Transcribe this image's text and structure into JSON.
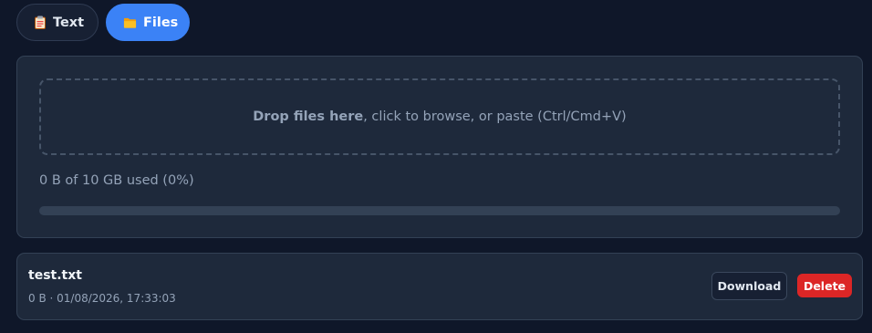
{
  "tabs": [
    {
      "label": "Text",
      "icon": "clipboard-icon",
      "active": false
    },
    {
      "label": "Files",
      "icon": "folder-icon",
      "active": true
    }
  ],
  "upload": {
    "drop_strong": "Drop files here",
    "drop_rest": ", click to browse, or paste (Ctrl/Cmd+V)",
    "usage_text": "0 B of 10 GB used (0%)",
    "usage_fraction": 0
  },
  "files": [
    {
      "name": "test.txt",
      "meta": "0 B · 01/08/2026, 17:33:03",
      "download_label": "Download",
      "delete_label": "Delete"
    }
  ],
  "colors": {
    "background": "#0f1729",
    "card": "#1e293b",
    "accent": "#3b82f6",
    "danger": "#dc2626"
  }
}
